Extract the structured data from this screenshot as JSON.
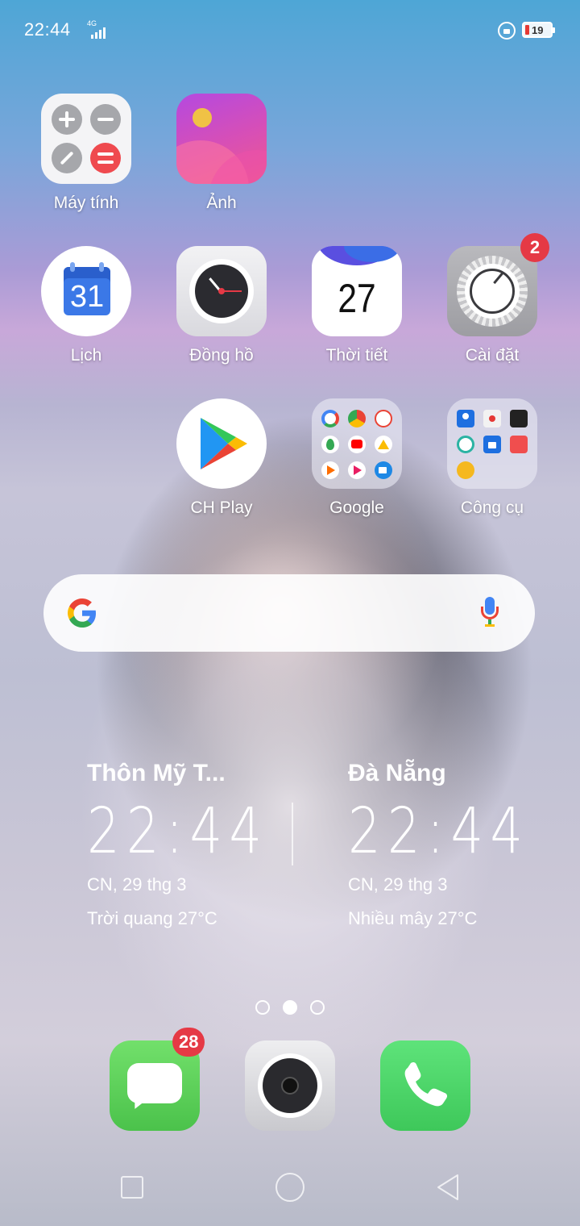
{
  "status_bar": {
    "time": "22:44",
    "network": "4G",
    "battery_level": "19"
  },
  "apps": {
    "calculator": {
      "label": "Máy tính"
    },
    "photos": {
      "label": "Ảnh"
    },
    "calendar": {
      "label": "Lịch",
      "day": "31"
    },
    "clock": {
      "label": "Đồng hồ"
    },
    "weather": {
      "label": "Thời tiết",
      "day": "27"
    },
    "settings": {
      "label": "Cài đặt",
      "badge": "2"
    },
    "play_store": {
      "label": "CH Play"
    },
    "google_folder": {
      "label": "Google"
    },
    "tools_folder": {
      "label": "Công cụ"
    }
  },
  "search_bar": {
    "logo": "G"
  },
  "clocks": [
    {
      "city": "Thôn Mỹ T...",
      "time": "22:44",
      "date": "CN, 29 thg 3",
      "weather": "Trời quang 27°C"
    },
    {
      "city": "Đà Nẵng",
      "time": "22:44",
      "date": "CN, 29 thg 3",
      "weather": "Nhiều mây 27°C"
    }
  ],
  "page_indicator": {
    "pages": 3,
    "current": 2
  },
  "dock": {
    "messages": {
      "badge": "28"
    }
  },
  "colors": {
    "badge": "#e53945",
    "messages": "#5fd35f",
    "phone": "#55d466",
    "play_blue": "#2196f3",
    "google_blue": "#4285f4"
  }
}
